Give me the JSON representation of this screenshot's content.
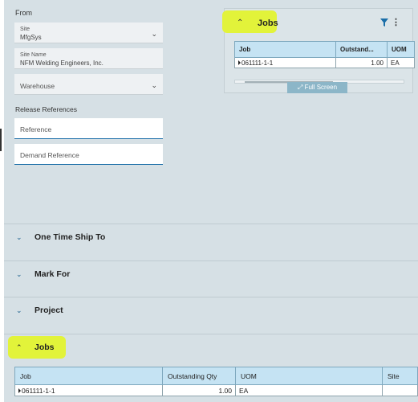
{
  "from": {
    "label": "From",
    "site": {
      "label": "Site",
      "value": "MfgSys"
    },
    "site_name": {
      "label": "Site Name",
      "value": "NFM Welding Engineers, Inc."
    },
    "warehouse": {
      "label": "Warehouse"
    }
  },
  "release_references": {
    "label": "Release References",
    "reference": {
      "placeholder": "Reference"
    },
    "demand_reference": {
      "placeholder": "Demand Reference"
    }
  },
  "jobs_card": {
    "title": "Jobs",
    "columns": [
      "Job",
      "Outstand...",
      "UOM"
    ],
    "rows": [
      {
        "job": "061111-1-1",
        "outstanding": "1.00",
        "uom": "EA"
      }
    ],
    "full_screen_label": "Full Screen"
  },
  "sections": {
    "one_time_ship_to": "One Time Ship To",
    "mark_for": "Mark For",
    "project": "Project",
    "jobs": "Jobs"
  },
  "jobs_table": {
    "columns": [
      "Job",
      "Outstanding Qty",
      "UOM",
      "Site"
    ],
    "rows": [
      {
        "job": "061111-1-1",
        "outstanding_qty": "1.00",
        "uom": "EA",
        "site": ""
      }
    ]
  },
  "colors": {
    "accent": "#1b6ea8",
    "header_bg": "#c5e3f3",
    "highlight": "#e2f33a",
    "panel_bg": "#d6e0e5"
  },
  "icons": {
    "collapse": "chevron-up-icon",
    "expand": "chevron-down-icon",
    "filter": "filter-icon",
    "more": "more-vertical-icon",
    "full_screen": "expand-arrows-icon"
  }
}
